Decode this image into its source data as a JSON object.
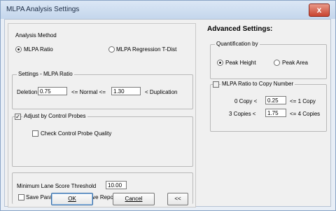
{
  "window": {
    "title": "MLPA Analysis Settings",
    "close_symbol": "x"
  },
  "analysis_method": {
    "label": "Analysis Method",
    "options": [
      {
        "label": "MLPA Ratio",
        "selected": true
      },
      {
        "label": "MLPA Regression T-Dist",
        "selected": false
      }
    ]
  },
  "settings_ratio": {
    "label": "Settings - MLPA Ratio",
    "deletion_prefix": "Deletion <",
    "deletion_value": "0.75",
    "normal_text": "<= Normal <=",
    "duplication_value": "1.30",
    "duplication_suffix": "< Duplication"
  },
  "control_probes": {
    "adjust_label": "Adjust by Control Probes",
    "adjust_checked": true,
    "check_quality_label": "Check Control Probe Quality",
    "check_quality_checked": false
  },
  "lane_score": {
    "label": "Minimum Lane Score Threshold",
    "value": "10.00",
    "save_params_label": "Save Parameters when Save Report",
    "save_params_checked": false
  },
  "buttons": {
    "ok": "OK",
    "cancel": "Cancel",
    "collapse": "<<"
  },
  "advanced": {
    "heading": "Advanced Settings:",
    "quantification": {
      "label": "Quantification by",
      "options": [
        {
          "label": "Peak Height",
          "selected": true
        },
        {
          "label": "Peak Area",
          "selected": false
        }
      ]
    },
    "copy_number": {
      "label": "MLPA Ratio to Copy Number",
      "checked": false,
      "row1_prefix": "0 Copy <",
      "row1_value": "0.25",
      "row1_suffix": "<= 1 Copy",
      "row2_prefix": "3 Copies <",
      "row2_value": "1.75",
      "row2_suffix": "<= 4 Copies"
    }
  }
}
